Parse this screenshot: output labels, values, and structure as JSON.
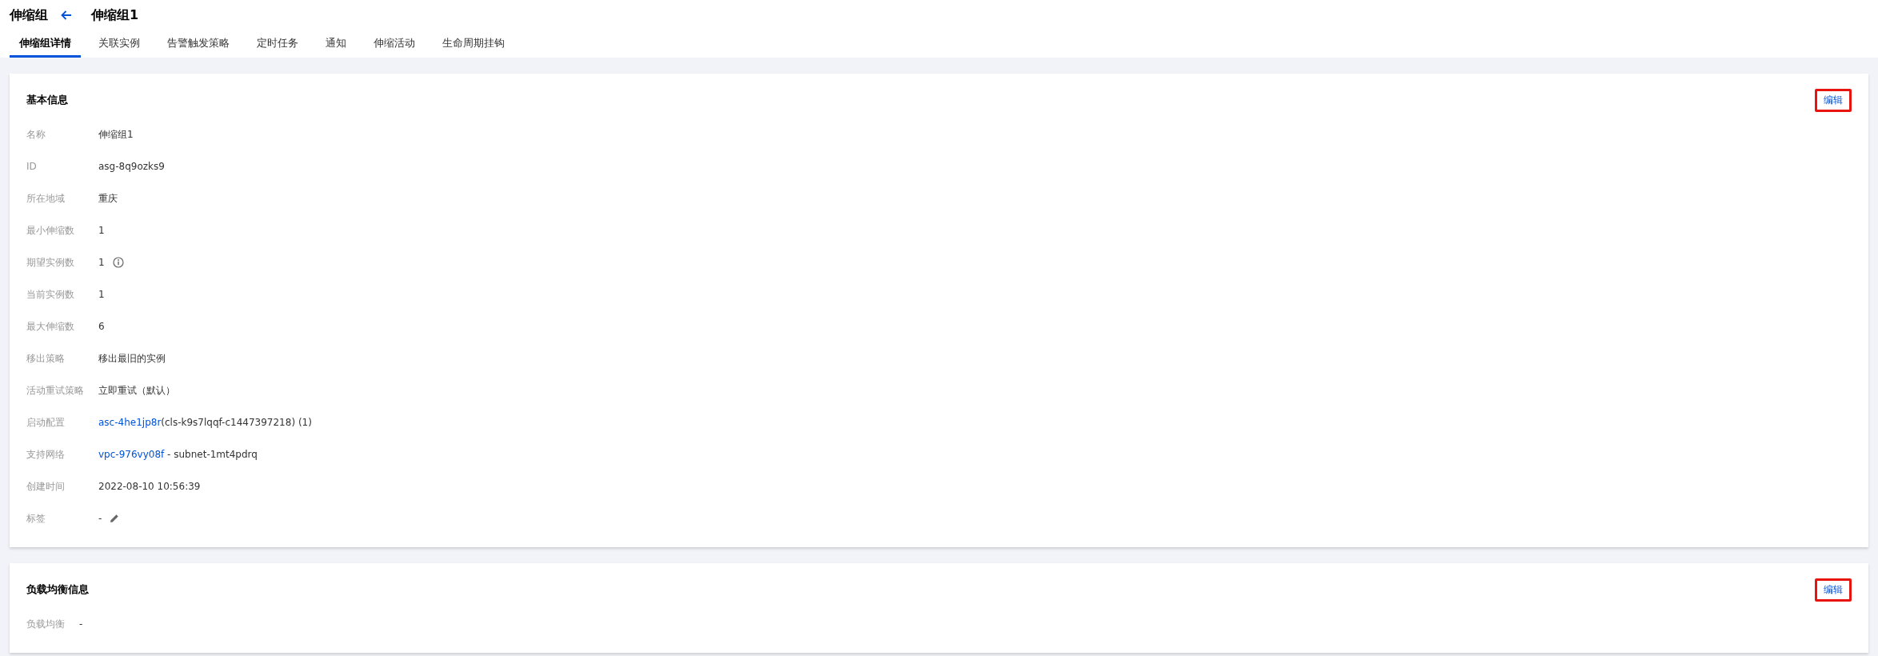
{
  "header": {
    "breadcrumb": "伸缩组",
    "title": "伸缩组1"
  },
  "tabs": [
    {
      "label": "伸缩组详情",
      "selected": true
    },
    {
      "label": "关联实例",
      "selected": false
    },
    {
      "label": "告警触发策略",
      "selected": false
    },
    {
      "label": "定时任务",
      "selected": false
    },
    {
      "label": "通知",
      "selected": false
    },
    {
      "label": "伸缩活动",
      "selected": false
    },
    {
      "label": "生命周期挂钩",
      "selected": false
    }
  ],
  "sections": [
    {
      "title": "基本信息",
      "edit_button": {
        "label": "编辑",
        "highlighted": true
      },
      "rows": [
        {
          "label": "名称",
          "value": [
            {
              "kind": "text",
              "text": "伸缩组1"
            }
          ]
        },
        {
          "label": "ID",
          "value": [
            {
              "kind": "text",
              "text": "asg-8q9ozks9"
            }
          ]
        },
        {
          "label": "所在地域",
          "value": [
            {
              "kind": "text",
              "text": "重庆"
            }
          ]
        },
        {
          "label": "最小伸缩数",
          "value": [
            {
              "kind": "text",
              "text": "1"
            }
          ]
        },
        {
          "label": "期望实例数",
          "value": [
            {
              "kind": "text",
              "text": "1"
            }
          ],
          "info_icon": true
        },
        {
          "label": "当前实例数",
          "value": [
            {
              "kind": "text",
              "text": "1"
            }
          ]
        },
        {
          "label": "最大伸缩数",
          "value": [
            {
              "kind": "text",
              "text": "6"
            }
          ]
        },
        {
          "label": "移出策略",
          "value": [
            {
              "kind": "text",
              "text": "移出最旧的实例"
            }
          ]
        },
        {
          "label": "活动重试策略",
          "value": [
            {
              "kind": "text",
              "text": "立即重试（默认）"
            }
          ]
        },
        {
          "label": "启动配置",
          "value": [
            {
              "kind": "link",
              "text": "asc-4he1jp8r"
            },
            {
              "kind": "text",
              "text": "(cls-k9s7lqqf-c1447397218) (1)"
            }
          ]
        },
        {
          "label": "支持网络",
          "value": [
            {
              "kind": "link",
              "text": "vpc-976vy08f"
            },
            {
              "kind": "text",
              "text": " - subnet-1mt4pdrq"
            }
          ]
        },
        {
          "label": "创建时间",
          "value": [
            {
              "kind": "text",
              "text": "2022-08-10 10:56:39"
            }
          ]
        },
        {
          "label": "标签",
          "value": [
            {
              "kind": "text",
              "text": "-"
            }
          ],
          "edit_icon": true
        }
      ]
    },
    {
      "title": "负载均衡信息",
      "edit_button": {
        "label": "编辑",
        "highlighted": true
      },
      "rows": [
        {
          "label": "负载均衡",
          "value": [
            {
              "kind": "text",
              "text": "-"
            }
          ]
        }
      ]
    }
  ]
}
